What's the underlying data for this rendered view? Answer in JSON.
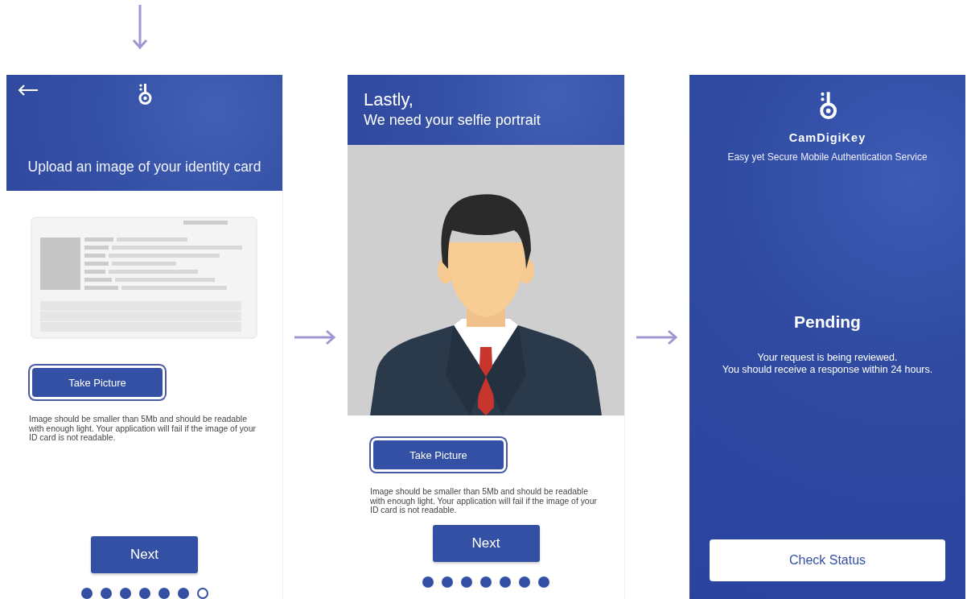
{
  "screens": [
    {
      "kind": "upload_id",
      "header": {
        "title": "Upload an image of your identity card"
      },
      "take_picture_button": "Take Picture",
      "note": "Image should be smaller than 5Mb and should be readable with enough light. Your application will fail if the image of your ID card is not readable.",
      "next_button": "Next",
      "page_dots": [
        {
          "filled": true
        },
        {
          "filled": true
        },
        {
          "filled": true
        },
        {
          "filled": true
        },
        {
          "filled": true
        },
        {
          "filled": true
        },
        {
          "filled": false
        }
      ]
    },
    {
      "kind": "selfie",
      "header": {
        "title": "Lastly,",
        "subtitle": "We need your selfie portrait"
      },
      "take_picture_button": "Take Picture",
      "note": "Image should be smaller than 5Mb and should be readable with enough light. Your application will fail if the image of your ID card is not readable.",
      "next_button": "Next",
      "page_dots": [
        {
          "filled": true
        },
        {
          "filled": true
        },
        {
          "filled": true
        },
        {
          "filled": true
        },
        {
          "filled": true
        },
        {
          "filled": true
        },
        {
          "filled": true
        }
      ]
    },
    {
      "kind": "pending",
      "app_name": "CamDigiKey",
      "tagline": "Easy yet Secure Mobile Authentication Service",
      "status_title": "Pending",
      "message_lines": [
        "Your request is being reviewed.",
        "You should receive a response within 24 hours."
      ],
      "check_status_button": "Check Status"
    }
  ]
}
